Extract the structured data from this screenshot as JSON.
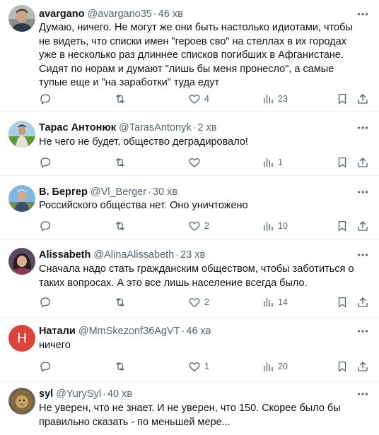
{
  "replies": [
    {
      "name": "avargano",
      "handle": "@avargano35",
      "time": "46 хв",
      "text": "Думаю, ничего. Не могут же они быть настолько идиотами, чтобы не видеть, что списки имен \"героев сво\" на стеллах в их городах уже в несколько раз длиннее списков погибших в Афганистане. Сидят по норам и думают \"лишь бы меня пронесло\", а самые тупые еще и \"на заработки\" туда едут",
      "replies_count": "",
      "reposts": "",
      "likes": "4",
      "views": "23",
      "avatar": "photo-man"
    },
    {
      "name": "Тарас Антонюк",
      "handle": "@TarasAntonyk",
      "time": "2 хв",
      "text": "Не чего не будет, общество деградировало!",
      "replies_count": "",
      "reposts": "",
      "likes": "",
      "views": "1",
      "avatar": "photo-field"
    },
    {
      "name": "В. Бергер",
      "handle": "@Vl_Berger",
      "time": "30 хв",
      "text": "Российского общества нет. Оно уничтожено",
      "replies_count": "",
      "reposts": "",
      "likes": "2",
      "views": "10",
      "avatar": "photo-sky"
    },
    {
      "name": "Alissabeth",
      "handle": "@AlinaAlissabeth",
      "time": "23 хв",
      "text": "Сначала надо стать гражданским обществом, чтобы заботиться о таких вопросах. А это все лишь население всегда было.",
      "replies_count": "",
      "reposts": "",
      "likes": "2",
      "views": "14",
      "avatar": "photo-woman"
    },
    {
      "name": "Натали",
      "handle": "@MmSkezonf36AgVT",
      "time": "46 хв",
      "text": "ничего",
      "replies_count": "",
      "reposts": "",
      "likes": "1",
      "views": "20",
      "avatar": "letter-H",
      "avatar_letter": "Н"
    },
    {
      "name": "syl",
      "handle": "@YurySyl",
      "time": "40 хв",
      "text": "Не уверен, что не знает. И не уверен, что 150. Скорее было бы правильно сказать - по меньшей мере...",
      "avatar": "photo-lion"
    }
  ],
  "colors": {
    "text": "#0f1419",
    "secondary": "#536471",
    "divider": "#eff3f4",
    "avatar_letter_bg": "#d9453a"
  },
  "icons": {
    "reply": "reply-icon",
    "repost": "repost-icon",
    "like": "like-icon",
    "views": "views-icon",
    "bookmark": "bookmark-icon",
    "share": "share-icon",
    "more": "more-icon"
  }
}
